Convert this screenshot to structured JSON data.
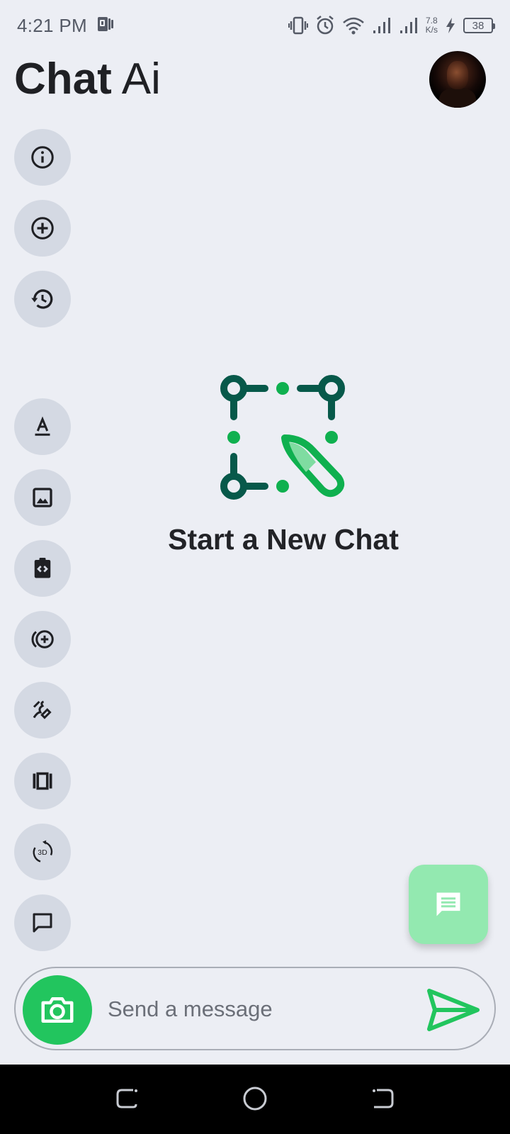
{
  "status_bar": {
    "time": "4:21 PM",
    "net_speed_value": "7.8",
    "net_speed_unit": "K/s",
    "battery_level": "38"
  },
  "header": {
    "title_bold": "Chat",
    "title_light": "Ai"
  },
  "side_tools": [
    {
      "icon": "info-icon"
    },
    {
      "icon": "add-circle-icon"
    },
    {
      "icon": "history-icon"
    },
    {
      "icon": "text-format-icon"
    },
    {
      "icon": "image-icon"
    },
    {
      "icon": "code-clipboard-icon"
    },
    {
      "icon": "add-circle-wave-icon"
    },
    {
      "icon": "draw-icon"
    },
    {
      "icon": "carousel-icon"
    },
    {
      "icon": "3d-rotation-icon"
    },
    {
      "icon": "chat-bubble-icon"
    }
  ],
  "rotation_icon_label": "3D",
  "empty_state": {
    "title": "Start a New Chat"
  },
  "composer": {
    "placeholder": "Send a message",
    "value": ""
  },
  "colors": {
    "accent": "#22c55e",
    "fab": "#93e9b0",
    "logo_dark": "#07594a",
    "logo_green": "#0fb04f",
    "background": "#eceef4",
    "side_button": "#d4d9e3"
  }
}
